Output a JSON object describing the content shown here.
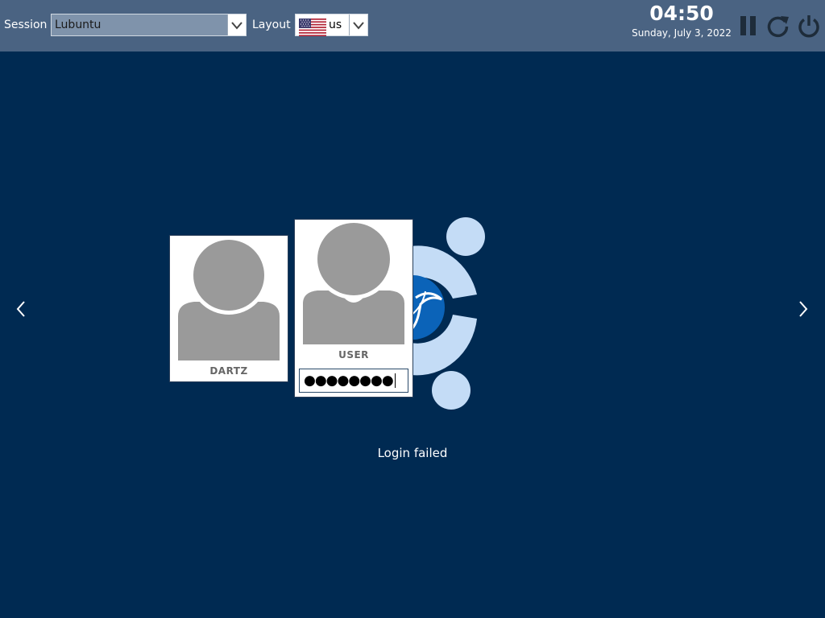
{
  "topbar": {
    "session_label": "Session",
    "session_value": "Lubuntu",
    "layout_label": "Layout",
    "layout_value": "us",
    "clock": "04:50",
    "date": "Sunday, July 3, 2022"
  },
  "users": [
    {
      "name": "DARTZ"
    },
    {
      "name": "USER"
    }
  ],
  "password": {
    "masked_value": "●●●●●●●●"
  },
  "status_message": "Login failed",
  "icons": {
    "session_dropdown": "chevron-down-icon",
    "layout_flag": "us-flag-icon",
    "suspend": "pause-icon",
    "restart": "restart-icon",
    "shutdown": "power-icon",
    "prev": "chevron-left-icon",
    "next": "chevron-right-icon"
  },
  "colors": {
    "background": "#002a52",
    "topbar": "#4a6382",
    "logo_light": "#c4dcf6",
    "logo_accent": "#0b63b8",
    "avatar_gray": "#9a9a9a"
  }
}
